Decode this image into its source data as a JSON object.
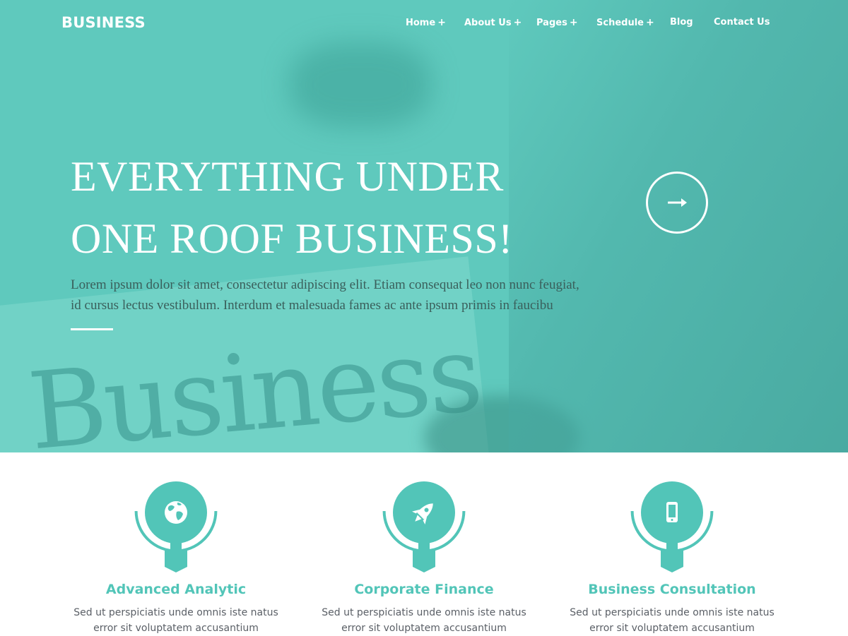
{
  "brand": {
    "logo": "BUSINESS",
    "accent": "#52c5b8"
  },
  "nav": {
    "items": [
      {
        "label": "Home",
        "has_submenu": true
      },
      {
        "label": "About Us",
        "has_submenu": true
      },
      {
        "label": "Pages",
        "has_submenu": true
      },
      {
        "label": "Schedule",
        "has_submenu": true
      },
      {
        "label": "Blog",
        "has_submenu": false
      },
      {
        "label": "Contact Us",
        "has_submenu": false
      }
    ],
    "submenu_indicator": "+"
  },
  "hero": {
    "title_line1": "EVERYTHING UNDER",
    "title_line2": "ONE ROOF BUSINESS!",
    "description_line1": "Lorem ipsum dolor sit amet, consectetur adipiscing elit. Etiam consequat leo non nunc feugiat,",
    "description_line2": "id cursus lectus vestibulum. Interdum et malesuada fames ac ante ipsum primis in faucibu",
    "background_word": "Business",
    "next_icon": "arrow-right-icon"
  },
  "features": [
    {
      "icon": "globe-icon",
      "title": "Advanced Analytic",
      "desc_line1": "Sed ut perspiciatis unde omnis iste natus",
      "desc_line2": "error sit voluptatem accusantium"
    },
    {
      "icon": "rocket-icon",
      "title": "Corporate Finance",
      "desc_line1": "Sed ut perspiciatis unde omnis iste natus",
      "desc_line2": "error sit voluptatem accusantium"
    },
    {
      "icon": "mobile-phone-icon",
      "title": "Business Consultation",
      "desc_line1": "Sed ut perspiciatis unde omnis iste natus",
      "desc_line2": "error sit voluptatem accusantium"
    }
  ]
}
